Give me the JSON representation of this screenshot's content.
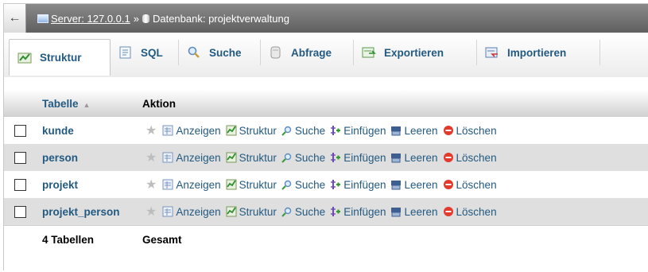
{
  "breadcrumb": {
    "back": "←",
    "server": "Server: 127.0.0.1",
    "sep": "»",
    "database": "Datenbank: projektverwaltung"
  },
  "tabs": [
    {
      "label": "Struktur",
      "icon": "structure-icon",
      "active": true
    },
    {
      "label": "SQL",
      "icon": "sql-icon"
    },
    {
      "label": "Suche",
      "icon": "search-icon"
    },
    {
      "label": "Abfrage",
      "icon": "query-icon"
    },
    {
      "label": "Exportieren",
      "icon": "export-icon"
    },
    {
      "label": "Importieren",
      "icon": "import-icon"
    }
  ],
  "table": {
    "col_table": "Tabelle",
    "col_action": "Aktion",
    "actions": [
      "Anzeigen",
      "Struktur",
      "Suche",
      "Einfügen",
      "Leeren",
      "Löschen"
    ],
    "rows": [
      "kunde",
      "person",
      "projekt",
      "projekt_person"
    ],
    "footer_count": "4 Tabellen",
    "footer_total": "Gesamt"
  },
  "colors": {
    "link": "#235a81",
    "topbar": "#6b6b6b",
    "row_alt": "#dfdfdf"
  }
}
